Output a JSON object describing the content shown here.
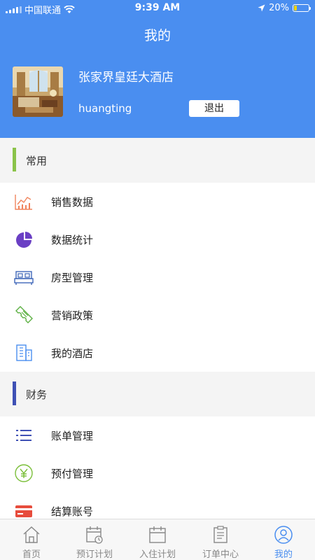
{
  "status_bar": {
    "carrier": "中国联通",
    "time": "9:39 AM",
    "battery": "20%"
  },
  "header": {
    "title": "我的",
    "hotel_name": "张家界皇廷大酒店",
    "username": "huangting",
    "logout_label": "退出"
  },
  "sections": [
    {
      "label": "常用",
      "accent": "#8bc34a",
      "items": [
        {
          "label": "销售数据",
          "icon": "sales-chart-icon"
        },
        {
          "label": "数据统计",
          "icon": "pie-chart-icon"
        },
        {
          "label": "房型管理",
          "icon": "bed-icon"
        },
        {
          "label": "营销政策",
          "icon": "ticket-icon"
        },
        {
          "label": "我的酒店",
          "icon": "building-icon"
        }
      ]
    },
    {
      "label": "财务",
      "accent": "#3f51b5",
      "items": [
        {
          "label": "账单管理",
          "icon": "list-icon"
        },
        {
          "label": "预付管理",
          "icon": "yen-icon"
        },
        {
          "label": "结算账号",
          "icon": "card-icon"
        }
      ]
    }
  ],
  "tabs": [
    {
      "label": "首页",
      "icon": "home-icon"
    },
    {
      "label": "预订计划",
      "icon": "calendar-clock-icon"
    },
    {
      "label": "入住计划",
      "icon": "calendar-icon"
    },
    {
      "label": "订单中心",
      "icon": "clipboard-icon"
    },
    {
      "label": "我的",
      "icon": "user-icon",
      "active": true
    }
  ],
  "colors": {
    "brand": "#4a8ef0"
  }
}
